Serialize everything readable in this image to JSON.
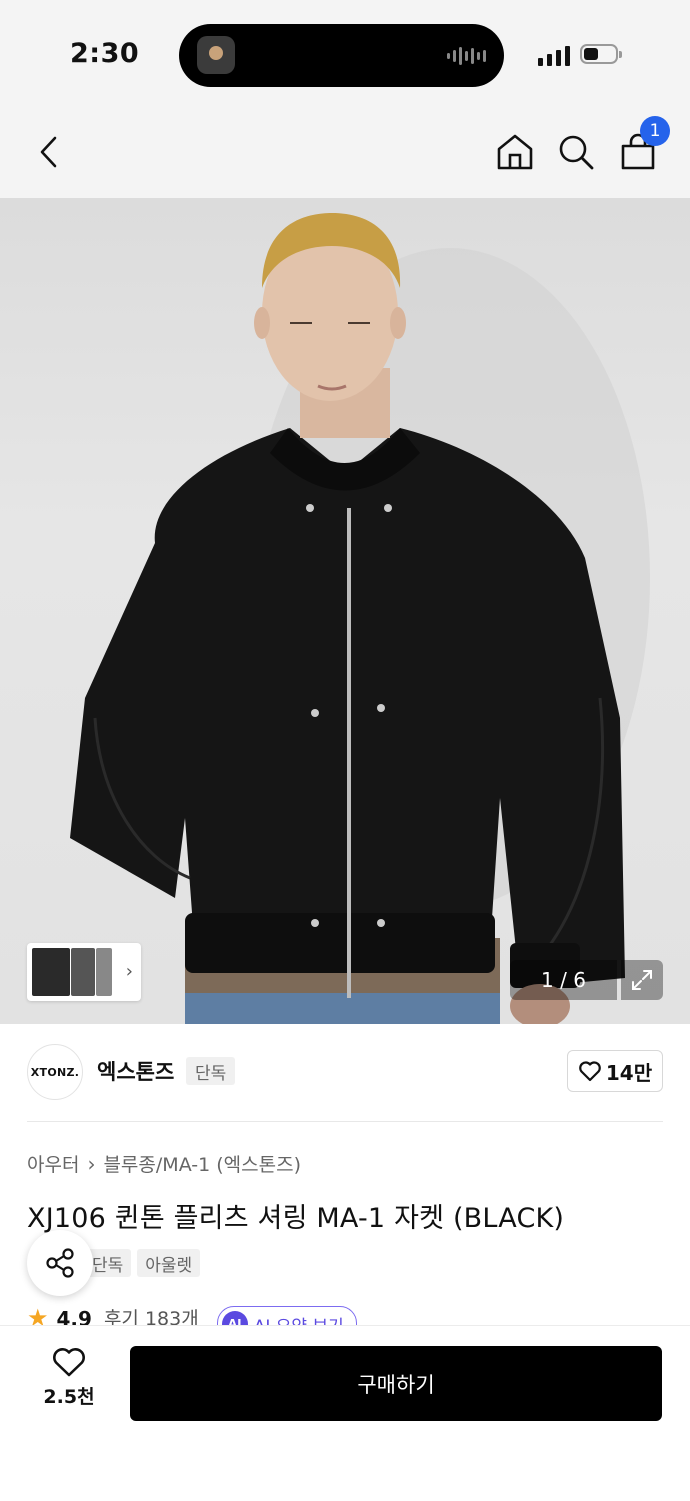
{
  "status_bar": {
    "time": "2:30"
  },
  "nav": {
    "back_icon": "chevron-left-icon",
    "home_icon": "home-icon",
    "search_icon": "search-icon",
    "cart_icon": "bag-icon",
    "cart_badge": "1",
    "badge_color": "#2563eb"
  },
  "gallery": {
    "page_indicator": "1 / 6"
  },
  "brand": {
    "logo_text": "XTONZ.",
    "name": "엑스톤즈",
    "tag": "단독",
    "likes": "14만"
  },
  "product": {
    "breadcrumb": [
      "아우터",
      "블루종/MA-1 (엑스톤즈)"
    ],
    "title": "XJ106 퀸톤 플리츠 셔링 MA-1 자켓 (BLACK)",
    "tags": [
      "단독",
      "아울렛"
    ],
    "rating": "4.9",
    "reviews": "후기 183개",
    "ai_badge": "AI",
    "ai_summary": "AI 요약 보기"
  },
  "bottom_bar": {
    "wish_count": "2.5천",
    "buy_label": "구매하기"
  }
}
